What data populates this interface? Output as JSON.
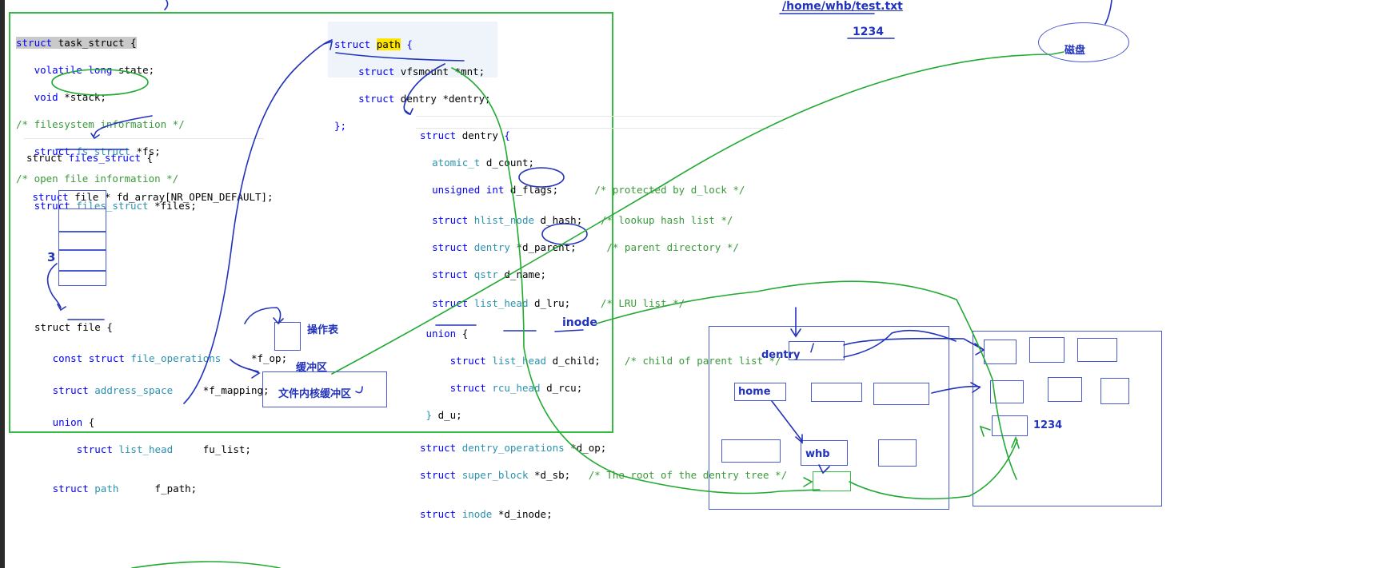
{
  "task_struct": {
    "line1": [
      "struct",
      "task_struct",
      "{"
    ],
    "line2": [
      "volatile",
      "long",
      "state;"
    ],
    "line3": [
      "void",
      "*stack;"
    ],
    "line4": "/* filesystem information */",
    "line5": [
      "struct",
      "fs_struct",
      "*fs;"
    ],
    "line6": "/* open file information */",
    "line7": [
      "struct",
      "files_struct",
      "*files;"
    ]
  },
  "files_struct": {
    "line1": [
      "struct",
      "files_struct",
      "{"
    ],
    "line2": [
      "struct",
      "file * fd_array[",
      "NR_OPEN_DEFAULT",
      "];"
    ]
  },
  "fd_marker": "3",
  "file_struct": {
    "line1": [
      "struct",
      "file",
      "{"
    ],
    "line2": [
      "const struct",
      "file_operations",
      "*f_op;"
    ],
    "line3": [
      "struct",
      "address_space",
      "*f_mapping;"
    ],
    "line4": [
      "union",
      "{"
    ],
    "line5": [
      "struct",
      "list_head",
      "fu_list;"
    ],
    "line6": [
      "struct",
      "path",
      "f_path;"
    ]
  },
  "path_struct": {
    "line1": [
      "struct",
      "path",
      "{"
    ],
    "line2": [
      "struct",
      "vfsmount *mnt;"
    ],
    "line3": [
      "struct",
      "dentry *dentry;"
    ],
    "line4": "};"
  },
  "dentry_struct": {
    "line1": [
      "struct",
      "dentry",
      "{"
    ],
    "line2": [
      "atomic_t",
      "d_count;"
    ],
    "line3": [
      "unsigned int",
      "d_flags;",
      "/* protected by d_lock */"
    ],
    "line4": [
      "struct",
      "hlist_node",
      "d_hash;",
      "/* lookup hash list */"
    ],
    "line5": [
      "struct",
      "dentry",
      "*d_parent;",
      "/* parent directory */"
    ],
    "line6": [
      "struct",
      "qstr",
      "d_name;"
    ],
    "line7": [
      "struct",
      "list_head",
      "d_lru;",
      "/* LRU list */"
    ],
    "line8": [
      "union",
      "{"
    ],
    "line9": [
      "struct",
      "list_head",
      "d_child;",
      "/* child of parent list */"
    ],
    "line10": [
      "struct",
      "rcu_head",
      "d_rcu;"
    ],
    "line11": [
      "}",
      "d_u;"
    ],
    "line12": [
      "struct",
      "dentry_operations",
      "*d_op;"
    ],
    "line13": [
      "struct",
      "super_block",
      "*d_sb;",
      "/* The root of the dentry tree */"
    ],
    "line14": [
      "struct",
      "inode",
      "*d_inode;"
    ]
  },
  "annotations": {
    "path_text": "/home/whb/test.txt",
    "content_text": "1234",
    "disk": "磁盘",
    "ops_table": "操作表",
    "buffer": "缓冲区",
    "kernel_buffer": "文件内核缓冲区",
    "inode": "inode",
    "dentry": "dentry",
    "root": "/",
    "home": "home",
    "whb": "whb",
    "block_1234": "1234"
  },
  "colors": {
    "ink": "#2233bb",
    "green": "#22aa33",
    "keyword": "#0000ff",
    "type": "#2b91af",
    "comment": "#3a9a3a"
  }
}
